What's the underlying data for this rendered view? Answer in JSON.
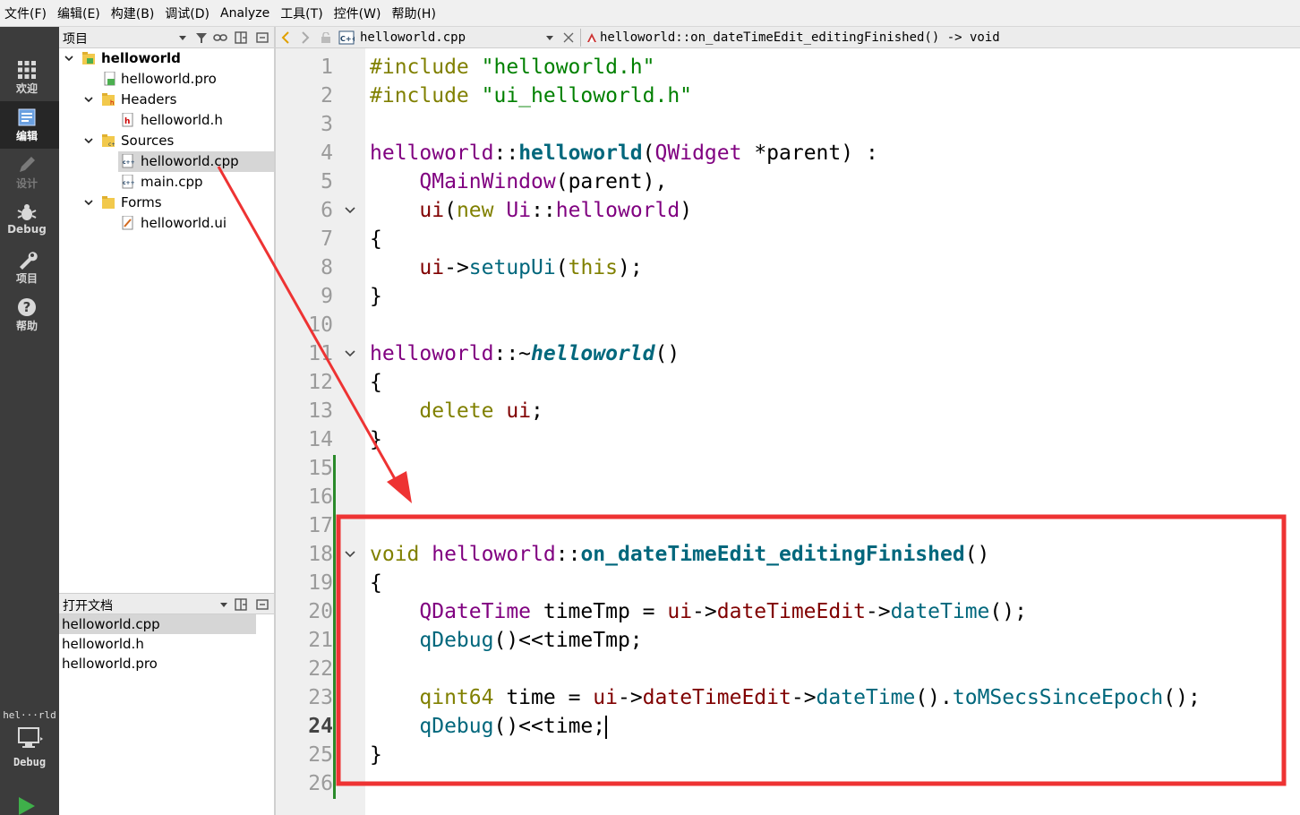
{
  "menu": [
    "文件(F)",
    "编辑(E)",
    "构建(B)",
    "调试(D)",
    "Analyze",
    "工具(T)",
    "控件(W)",
    "帮助(H)"
  ],
  "modes": [
    {
      "label": "欢迎",
      "icon": "grid-icon"
    },
    {
      "label": "编辑",
      "icon": "edit-document-icon"
    },
    {
      "label": "设计",
      "icon": "pencil-icon"
    },
    {
      "label": "Debug",
      "icon": "bug-icon"
    },
    {
      "label": "项目",
      "icon": "wrench-icon"
    },
    {
      "label": "帮助",
      "icon": "help-icon"
    }
  ],
  "session": {
    "name": "hel···rld",
    "build_mode": "Debug"
  },
  "project_pane": {
    "title": "项目"
  },
  "tree": {
    "project": "helloworld",
    "pro_file": "helloworld.pro",
    "headers_folder": "Headers",
    "header_file": "helloworld.h",
    "sources_folder": "Sources",
    "source_file_1": "helloworld.cpp",
    "source_file_2": "main.cpp",
    "forms_folder": "Forms",
    "form_file": "helloworld.ui"
  },
  "open_docs": {
    "title": "打开文档",
    "items": [
      "helloworld.cpp",
      "helloworld.h",
      "helloworld.pro"
    ]
  },
  "editor": {
    "file": "helloworld.cpp",
    "function": "helloworld::on_dateTimeEdit_editingFinished() -> void",
    "current_line": "24",
    "line_numbers": [
      "1",
      "2",
      "3",
      "4",
      "5",
      "6",
      "7",
      "8",
      "9",
      "10",
      "11",
      "12",
      "13",
      "14",
      "15",
      "16",
      "17",
      "18",
      "19",
      "20",
      "21",
      "22",
      "23",
      "24",
      "25",
      "26"
    ]
  },
  "code": [
    [
      [
        "#include ",
        "kw"
      ],
      [
        "\"helloworld.h\"",
        "str"
      ]
    ],
    [
      [
        "#include ",
        "kw"
      ],
      [
        "\"ui_helloworld.h\"",
        "str"
      ]
    ],
    [],
    [
      [
        "helloworld",
        "typ"
      ],
      [
        "::",
        ""
      ],
      [
        "helloworld",
        "fnb"
      ],
      [
        "(",
        ""
      ],
      [
        "QWidget",
        "typ"
      ],
      [
        " *parent) :",
        ""
      ]
    ],
    [
      [
        "    ",
        ""
      ],
      [
        "QMainWindow",
        "typ"
      ],
      [
        "(parent),",
        ""
      ]
    ],
    [
      [
        "    ",
        ""
      ],
      [
        "ui",
        "mem"
      ],
      [
        "(",
        ""
      ],
      [
        "new",
        "kw"
      ],
      [
        " ",
        ""
      ],
      [
        "Ui",
        "typ"
      ],
      [
        "::",
        ""
      ],
      [
        "helloworld",
        "typ"
      ],
      [
        ")",
        ""
      ]
    ],
    [
      [
        "{",
        ""
      ]
    ],
    [
      [
        "    ",
        ""
      ],
      [
        "ui",
        "mem"
      ],
      [
        "->",
        ""
      ],
      [
        "setupUi",
        "fn"
      ],
      [
        "(",
        ""
      ],
      [
        "this",
        "kw"
      ],
      [
        ");",
        ""
      ]
    ],
    [
      [
        "}",
        ""
      ]
    ],
    [],
    [
      [
        "helloworld",
        "typ"
      ],
      [
        "::~",
        ""
      ],
      [
        "helloworld",
        "fni"
      ],
      [
        "()",
        ""
      ]
    ],
    [
      [
        "{",
        ""
      ]
    ],
    [
      [
        "    ",
        ""
      ],
      [
        "delete",
        "kw"
      ],
      [
        " ",
        ""
      ],
      [
        "ui",
        "mem"
      ],
      [
        ";",
        ""
      ]
    ],
    [
      [
        "}",
        ""
      ]
    ],
    [],
    [],
    [],
    [
      [
        "void",
        "kw"
      ],
      [
        " ",
        ""
      ],
      [
        "helloworld",
        "typ"
      ],
      [
        "::",
        ""
      ],
      [
        "on_dateTimeEdit_editingFinished",
        "fnb"
      ],
      [
        "()",
        ""
      ]
    ],
    [
      [
        "{",
        ""
      ]
    ],
    [
      [
        "    ",
        ""
      ],
      [
        "QDateTime",
        "typ"
      ],
      [
        " timeTmp = ",
        ""
      ],
      [
        "ui",
        "mem"
      ],
      [
        "->",
        ""
      ],
      [
        "dateTimeEdit",
        "mem"
      ],
      [
        "->",
        ""
      ],
      [
        "dateTime",
        "fn"
      ],
      [
        "();",
        ""
      ]
    ],
    [
      [
        "    ",
        ""
      ],
      [
        "qDebug",
        "fn"
      ],
      [
        "()<<timeTmp;",
        ""
      ]
    ],
    [],
    [
      [
        "    ",
        ""
      ],
      [
        "qint64",
        "kw"
      ],
      [
        " time = ",
        ""
      ],
      [
        "ui",
        "mem"
      ],
      [
        "->",
        ""
      ],
      [
        "dateTimeEdit",
        "mem"
      ],
      [
        "->",
        ""
      ],
      [
        "dateTime",
        "fn"
      ],
      [
        "().",
        ""
      ],
      [
        "toMSecsSinceEpoch",
        "fn"
      ],
      [
        "();",
        ""
      ]
    ],
    [
      [
        "    ",
        ""
      ],
      [
        "qDebug",
        "fn"
      ],
      [
        "()<<time;",
        ""
      ],
      [
        "|CURSOR|",
        ""
      ]
    ],
    [
      [
        "}",
        ""
      ]
    ],
    []
  ],
  "colors": {
    "annotation": "#ee3333",
    "change_bar": "#2a8a2a"
  }
}
